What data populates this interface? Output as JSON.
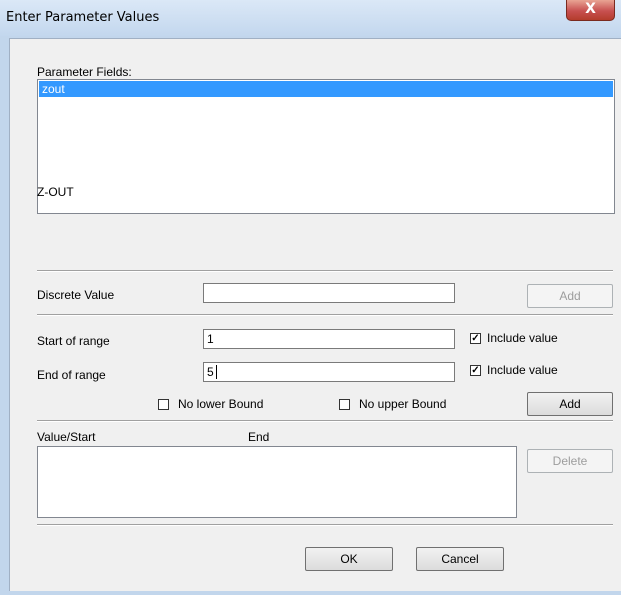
{
  "window": {
    "title": "Enter Parameter Values",
    "close_glyph": "X"
  },
  "parameter_fields": {
    "label": "Parameter Fields:",
    "items": [
      "zout"
    ],
    "selected": "zout",
    "description": "Z-OUT"
  },
  "discrete": {
    "label": "Discrete Value",
    "value": "",
    "add_label": "Add",
    "add_enabled": false
  },
  "range": {
    "start_label": "Start of range",
    "start_value": "1",
    "start_include_label": "Include value",
    "start_include_checked": true,
    "end_label": "End of range",
    "end_value": "5",
    "end_include_label": "Include value",
    "end_include_checked": true,
    "no_lower_label": "No lower Bound",
    "no_lower_checked": false,
    "no_upper_label": "No upper Bound",
    "no_upper_checked": false,
    "add_label": "Add"
  },
  "values_list": {
    "col_start": "Value/Start",
    "col_end": "End",
    "delete_label": "Delete",
    "delete_enabled": false
  },
  "footer": {
    "ok_label": "OK",
    "cancel_label": "Cancel"
  },
  "colors": {
    "selection": "#3399ff",
    "close": "#c75050",
    "frame": "#c2d6ec"
  }
}
